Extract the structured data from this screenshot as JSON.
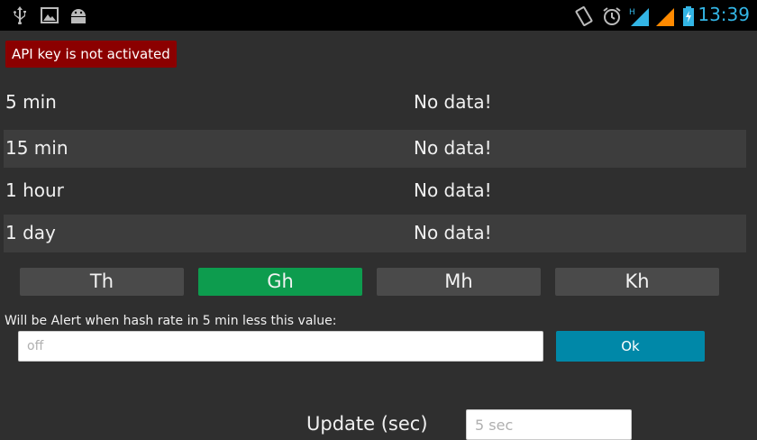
{
  "status_bar": {
    "time": "13:39",
    "left_icons": [
      "usb-icon",
      "image-icon",
      "android-icon"
    ],
    "right_icons": [
      "rotate-icon",
      "alarm-icon",
      "signal-h-icon",
      "signal-icon",
      "battery-charging-icon"
    ]
  },
  "api_badge": "API key is not activated",
  "hashrate_rows": [
    {
      "period": "5 min",
      "value": "No data!"
    },
    {
      "period": "15 min",
      "value": "No data!"
    },
    {
      "period": "1 hour",
      "value": "No data!"
    },
    {
      "period": "1 day",
      "value": "No data!"
    }
  ],
  "units": [
    {
      "label": "Th",
      "active": false
    },
    {
      "label": "Gh",
      "active": true
    },
    {
      "label": "Mh",
      "active": false
    },
    {
      "label": "Kh",
      "active": false
    }
  ],
  "alert": {
    "label": "Will be Alert when hash rate in 5 min less this value:",
    "placeholder": "off",
    "ok_label": "Ok"
  },
  "update": {
    "label": "Update (sec)",
    "placeholder": "5 sec"
  },
  "colors": {
    "background": "#2f2f2f",
    "badge": "#8b0000",
    "active_unit": "#0d9c4e",
    "ok_button": "#0088a8",
    "clock": "#33b5e5"
  }
}
